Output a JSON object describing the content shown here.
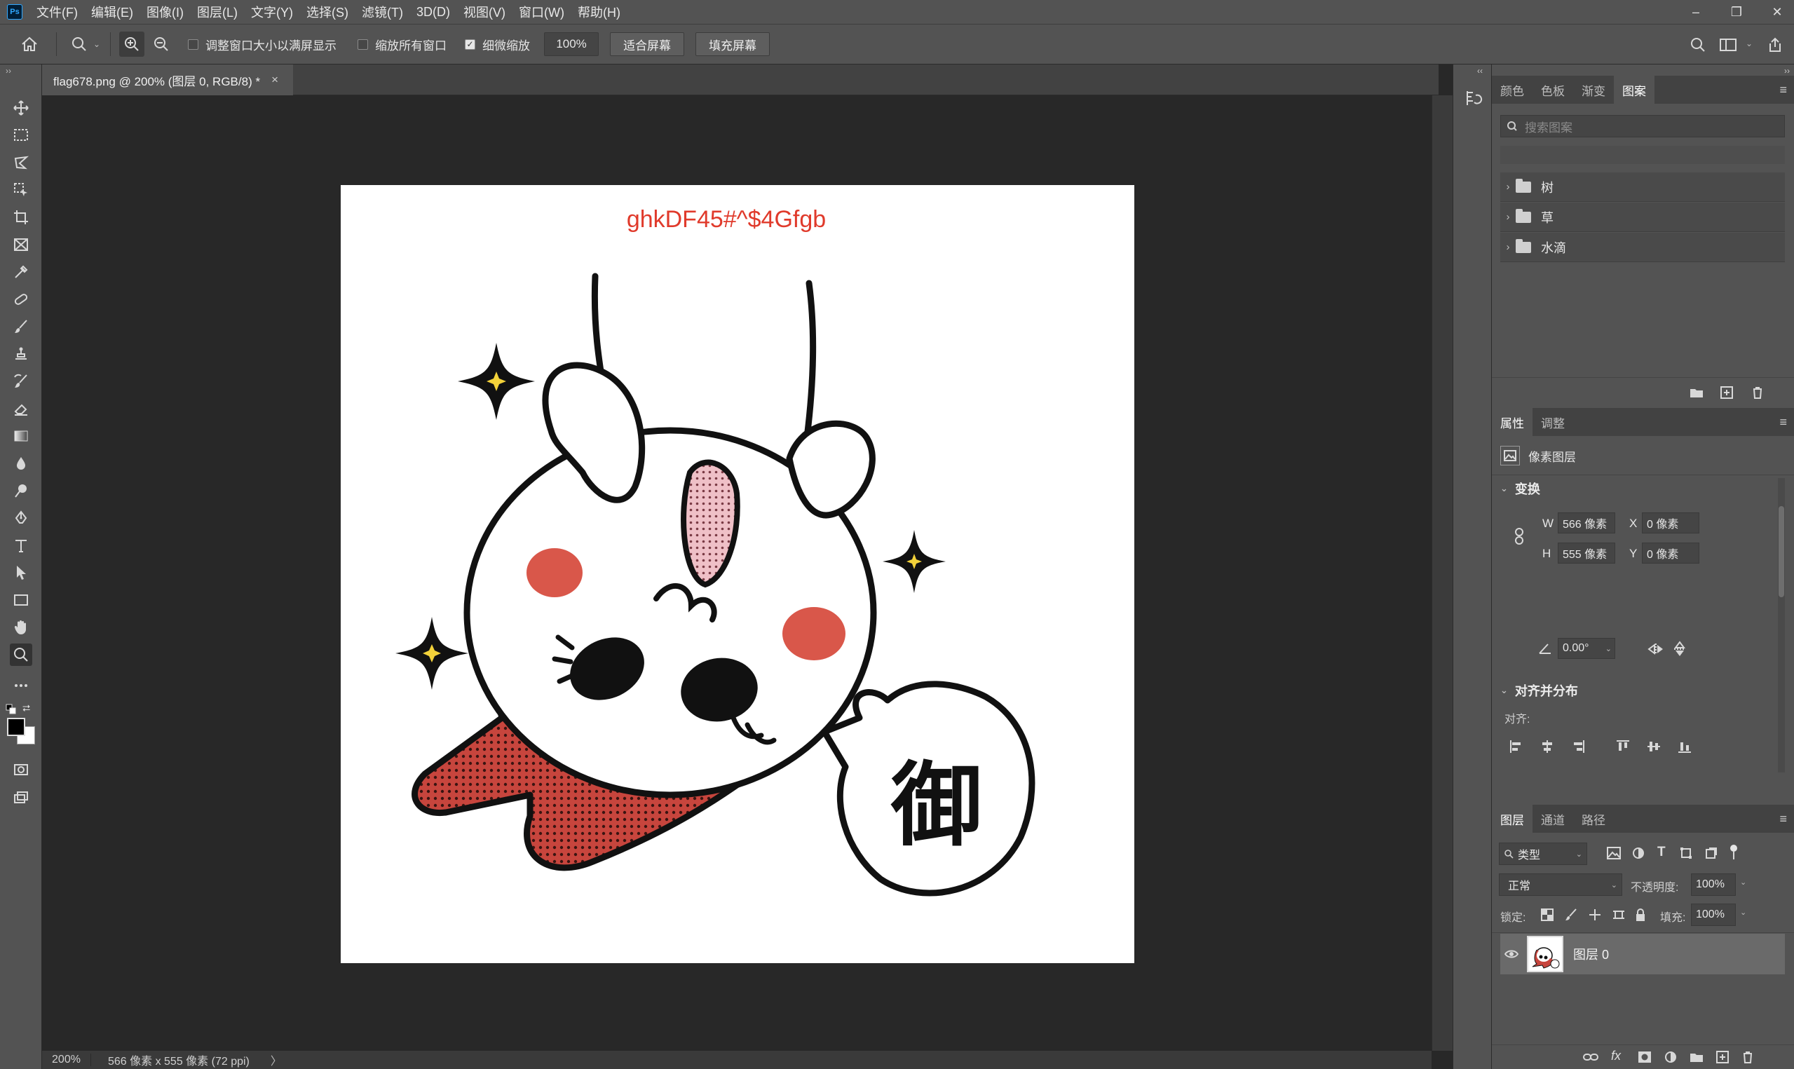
{
  "app": {
    "logo": "Ps"
  },
  "menu": [
    "文件(F)",
    "编辑(E)",
    "图像(I)",
    "图层(L)",
    "文字(Y)",
    "选择(S)",
    "滤镜(T)",
    "3D(D)",
    "视图(V)",
    "窗口(W)",
    "帮助(H)"
  ],
  "window_controls": {
    "minimize": "–",
    "restore": "❐",
    "close": "✕"
  },
  "options": {
    "resize_windows_label": "调整窗口大小以满屏显示",
    "resize_windows_checked": false,
    "zoom_all_label": "缩放所有窗口",
    "zoom_all_checked": false,
    "scrubby_zoom_label": "细微缩放",
    "scrubby_zoom_checked": true,
    "zoom_value": "100%",
    "fit_screen": "适合屏幕",
    "fill_screen": "填充屏幕"
  },
  "document": {
    "tab_title": "flag678.png @ 200% (图层 0, RGB/8) *",
    "close": "×",
    "overlay_text": "ghkDF45#^$4Gfgb",
    "speech_char": "御"
  },
  "status": {
    "zoom": "200%",
    "info": "566 像素 x 555 像素 (72 ppi)",
    "arrow": "〉"
  },
  "patterns_panel": {
    "tabs": [
      "颜色",
      "色板",
      "渐变",
      "图案"
    ],
    "active_tab": "图案",
    "search_placeholder": "搜索图案",
    "folders": [
      "树",
      "草",
      "水滴"
    ]
  },
  "properties_panel": {
    "tabs": [
      "属性",
      "调整"
    ],
    "active_tab": "属性",
    "layer_type": "像素图层",
    "transform_title": "变换",
    "w_label": "W",
    "w_value": "566 像素",
    "h_label": "H",
    "h_value": "555 像素",
    "x_label": "X",
    "x_value": "0 像素",
    "y_label": "Y",
    "y_value": "0 像素",
    "angle_value": "0.00°",
    "align_title": "对齐并分布",
    "align_label": "对齐:"
  },
  "layers_panel": {
    "tabs": [
      "图层",
      "通道",
      "路径"
    ],
    "active_tab": "图层",
    "filter_kind": "类型",
    "blend_mode": "正常",
    "opacity_label": "不透明度:",
    "opacity_value": "100%",
    "lock_label": "锁定:",
    "fill_label": "填充:",
    "fill_value": "100%",
    "layers": [
      {
        "name": "图层 0",
        "visible": true
      }
    ]
  },
  "colors": {
    "accent_text": "#e03a2b",
    "blush": "#d9574a",
    "ear_pink": "#e9a5b0",
    "body_red": "#c7453d"
  }
}
